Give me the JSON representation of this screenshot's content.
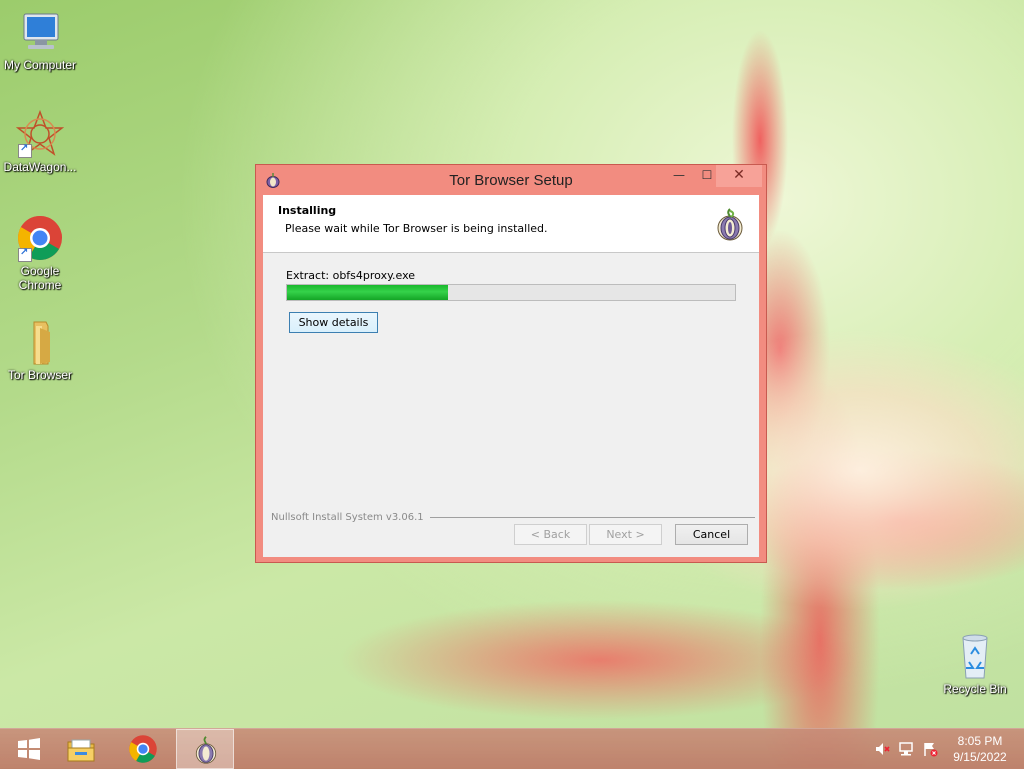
{
  "desktop": {
    "icons": [
      {
        "label": "My Computer",
        "icon": "computer-icon"
      },
      {
        "label": "DataWagon...",
        "icon": "datawagon-icon"
      },
      {
        "label": "Google Chrome",
        "icon": "chrome-icon"
      },
      {
        "label": "Tor Browser",
        "icon": "folder-icon"
      }
    ],
    "recycle_bin": {
      "label": "Recycle Bin",
      "icon": "recycle-bin-icon"
    }
  },
  "dialog": {
    "title": "Tor Browser Setup",
    "controls": {
      "minimize": "—",
      "maximize": "☐",
      "close": "✕"
    },
    "header": {
      "title": "Installing",
      "subtitle": "Please wait while Tor Browser is being installed.",
      "icon": "tor-onion-icon"
    },
    "status_text": "Extract: obfs4proxy.exe",
    "progress": 0.36,
    "show_details_label": "Show details",
    "branding": "Nullsoft Install System v3.06.1",
    "buttons": {
      "back": "< Back",
      "next": "Next >",
      "cancel": "Cancel"
    }
  },
  "taskbar": {
    "items": [
      {
        "name": "start-button",
        "icon": "windows-icon"
      },
      {
        "name": "file-explorer",
        "icon": "file-explorer-icon"
      },
      {
        "name": "chrome",
        "icon": "chrome-icon"
      },
      {
        "name": "tor-browser-setup",
        "icon": "tor-onion-icon",
        "active": true
      }
    ],
    "tray": [
      "speaker-muted-icon",
      "network-icon",
      "action-center-flag-icon"
    ],
    "clock": {
      "time": "8:05 PM",
      "date": "9/15/2022"
    }
  },
  "colors": {
    "dialog_frame": "#f28c80",
    "progress_fill": "#2cc640",
    "taskbar": "#c08a76"
  }
}
